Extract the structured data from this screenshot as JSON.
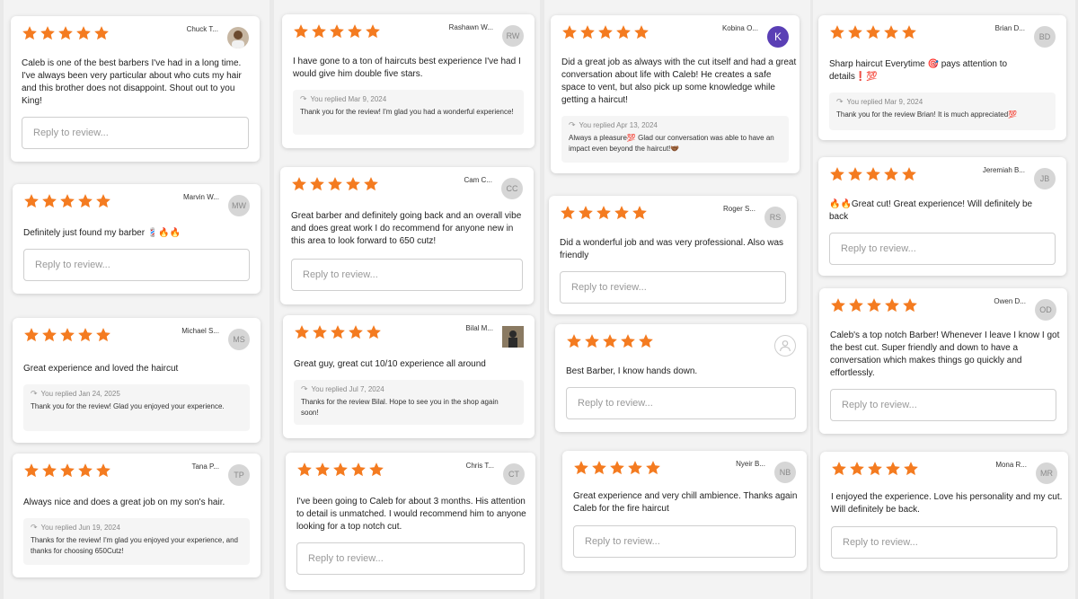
{
  "reply_placeholder": "Reply to review...",
  "colors": {
    "star": "#f47b20",
    "reply_bg": "#f5f5f5",
    "avatar_bg": "#d6d6d6",
    "purple_avatar": "#5a3fb5"
  },
  "reviews": [
    {
      "name": "Chuck T...",
      "avatar": "photo",
      "text": "Caleb is one of the best barbers I've had in a long time.  I've always been very particular about who cuts my hair and this brother does not disappoint.  Shout out to you King!"
    },
    {
      "name": "Marvin W...",
      "avatar": "MW",
      "text": "Definitely just found my barber 💈🔥🔥"
    },
    {
      "name": "Michael S...",
      "avatar": "MS",
      "text": "Great experience and loved the haircut",
      "reply_date": "You replied Jan 24, 2025",
      "reply_text": "Thank you for the review! Glad you enjoyed your experience."
    },
    {
      "name": "Tana P...",
      "avatar": "TP",
      "text": "Always nice and does a great job on my son's hair.",
      "reply_date": "You replied Jun 19, 2024",
      "reply_text": "Thanks for the review! I'm glad you enjoyed your experience, and thanks for choosing 650Cutz!"
    },
    {
      "name": "Rashawn W...",
      "avatar": "RW",
      "text": "I have gone to a ton of haircuts best experience I've had I would give him double five stars.",
      "reply_date": "You replied Mar 9, 2024",
      "reply_text": "Thank you for the review! I'm glad you had a wonderful experience!"
    },
    {
      "name": "Cam C...",
      "avatar": "CC",
      "text": "Great barber and definitely going back and an overall vibe and does great work I do recommend for anyone new in this area to look forward to 650 cutz!"
    },
    {
      "name": "Bilal M...",
      "avatar": "photo2",
      "text": "Great guy, great cut 10/10 experience all around",
      "reply_date": "You replied Jul 7, 2024",
      "reply_text": "Thanks for the review Bilal. Hope to see you in the shop again soon!"
    },
    {
      "name": "Chris T...",
      "avatar": "CT",
      "text": "I've been going to Caleb for about 3 months. His attention to detail is unmatched. I would recommend him to anyone looking for a top notch cut."
    },
    {
      "name": "Kobina O...",
      "avatar": "K",
      "text": "Did a great job as always with the cut itself and had a great conversation about life with Caleb! He creates a safe space to vent, but also pick up some knowledge while getting a haircut!",
      "reply_date": "You replied Apr 13, 2024",
      "reply_text": "Always a pleasure💯 Glad our conversation was able to have an impact even beyond the haircut!🤝🏾"
    },
    {
      "name": "Roger S...",
      "avatar": "RS",
      "text": "Did a wonderful job and was very professional. Also was friendly"
    },
    {
      "name": "",
      "avatar": "person-icon",
      "text": "Best Barber, I know hands down."
    },
    {
      "name": "Nyeir B...",
      "avatar": "NB",
      "text": "Great experience and very chill ambience. Thanks again Caleb for the fire haircut"
    },
    {
      "name": "Brian D...",
      "avatar": "BD",
      "text": "Sharp haircut Everytime 🎯 pays attention to details❗️💯",
      "reply_date": "You replied Mar 9, 2024",
      "reply_text": "Thank you for the review Brian! It is much appreciated💯"
    },
    {
      "name": "Jeremiah B...",
      "avatar": "JB",
      "text": "🔥🔥Great cut! Great experience! Will definitely be back"
    },
    {
      "name": "Owen D...",
      "avatar": "OD",
      "text": "Caleb's a top notch Barber! Whenever I leave I know I got the best cut. Super friendly and down to have a conversation which makes things go quickly and effortlessly."
    },
    {
      "name": "Mona R...",
      "avatar": "MR",
      "text": "I enjoyed the experience.  Love his personality and my cut. Will definitely be back."
    }
  ]
}
